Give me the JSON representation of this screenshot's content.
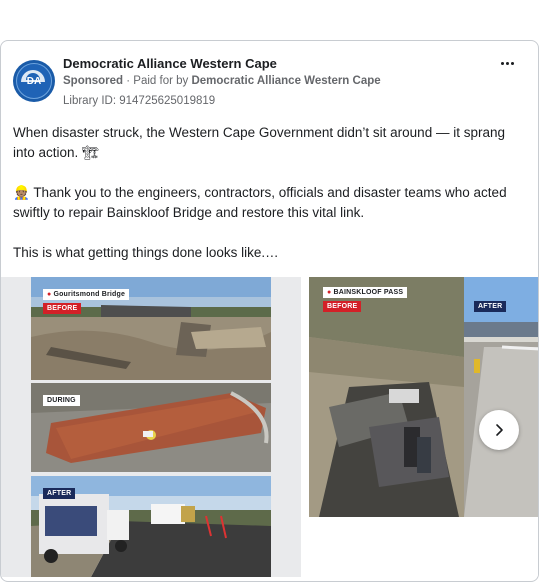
{
  "post": {
    "page_name": "Democratic Alliance Western Cape",
    "sponsored_label": "Sponsored",
    "paid_for_prefix": "· Paid for by",
    "paid_for_by": "Democratic Alliance Western Cape",
    "library_id": "Library ID: 914725625019819",
    "avatar_text": "DA",
    "more_icon": "more-horizontal-icon"
  },
  "body": {
    "paragraph1": "When disaster struck, the Western Cape Government didn’t sit around — it sprang into action. 🏗",
    "paragraph2": "👷🏽 Thank you to the engineers, contractors, officials and disaster teams who acted swiftly to repair Bainskloof Bridge and restore this vital link.",
    "paragraph3": "This is what getting things done looks like.…"
  },
  "carousel": {
    "slide1": {
      "location": "Gouritsmond Bridge",
      "before": "BEFORE",
      "during": "DURING",
      "after": "AFTER"
    },
    "slide2": {
      "location": "BAINSKLOOF PASS",
      "before": "BEFORE",
      "after": "AFTER"
    },
    "next_icon": "chevron-right-icon"
  }
}
